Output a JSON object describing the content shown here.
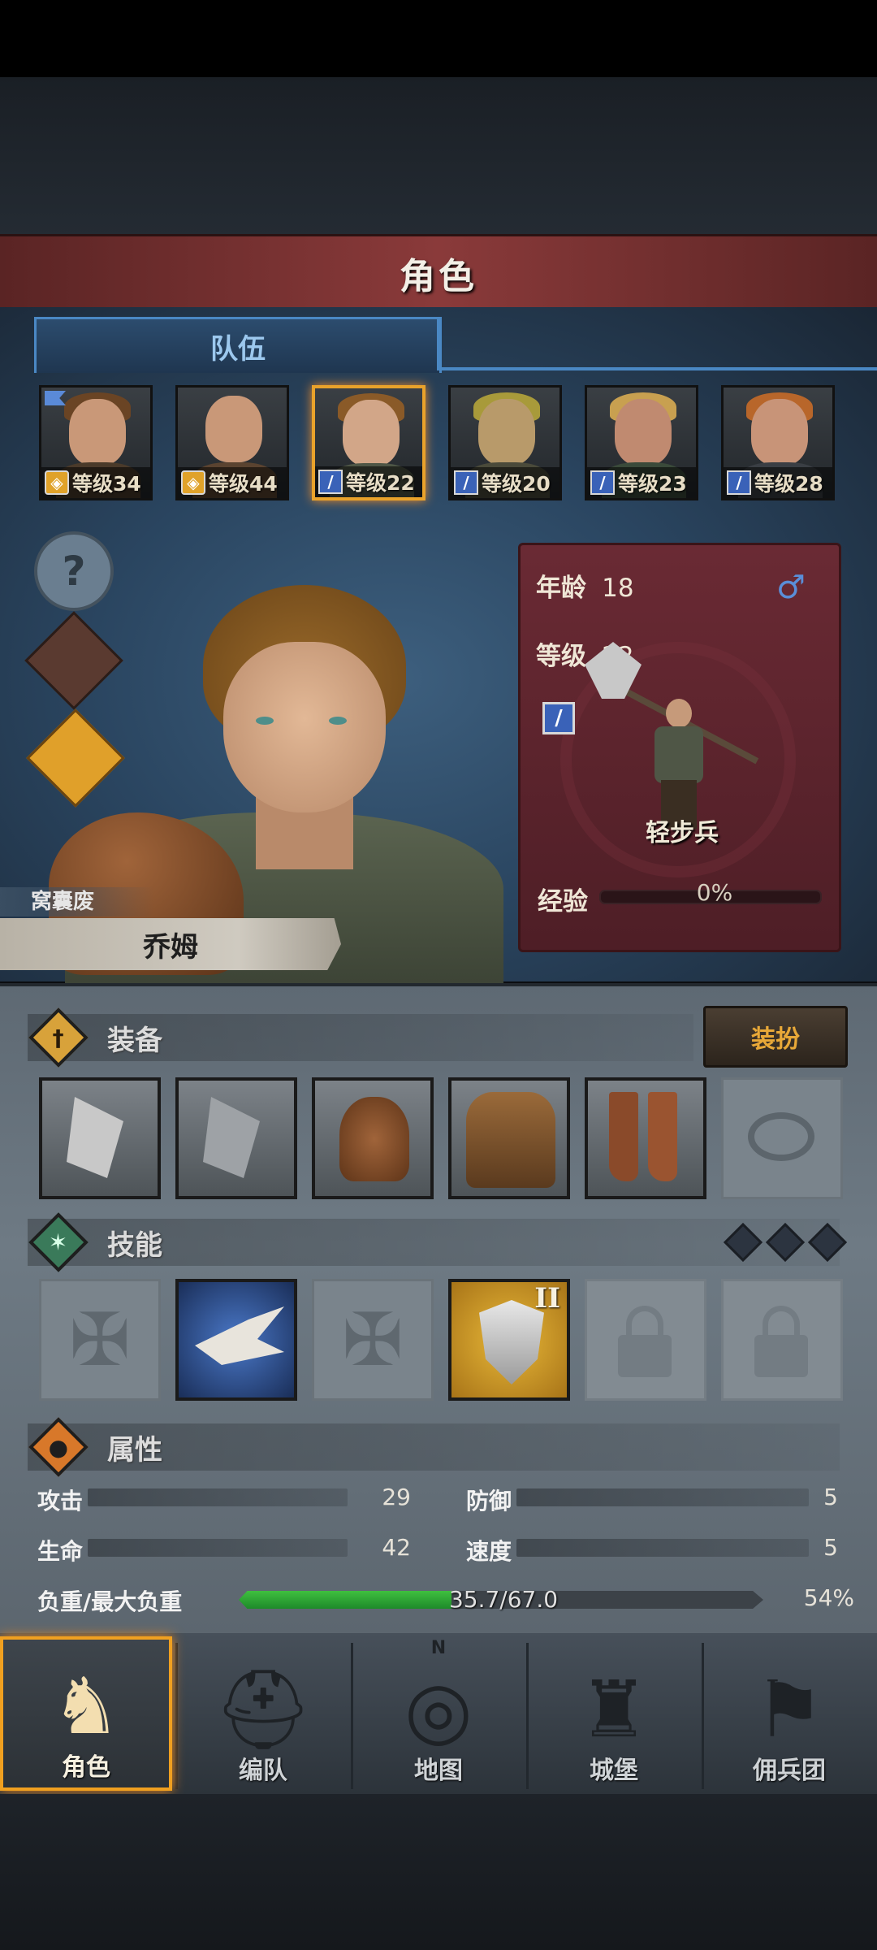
{
  "header": {
    "title": "角色"
  },
  "tabs": {
    "team": "队伍"
  },
  "roster": [
    {
      "level": "等级34",
      "class": "shield",
      "selected": false
    },
    {
      "level": "等级44",
      "class": "shield",
      "selected": false
    },
    {
      "level": "等级22",
      "class": "sword",
      "selected": true
    },
    {
      "level": "等级20",
      "class": "sword",
      "selected": false
    },
    {
      "level": "等级23",
      "class": "sword",
      "selected": false
    },
    {
      "level": "等级28",
      "class": "sword",
      "selected": false
    }
  ],
  "hero": {
    "title": "窝囊废",
    "name": "乔姆",
    "age_label": "年龄",
    "age": "18",
    "gender_symbol": "♂",
    "level_label": "等级",
    "level": "22",
    "unit": "轻步兵",
    "exp_label": "经验",
    "exp": "0%",
    "exp_fraction": 0
  },
  "equipment": {
    "title": "装备",
    "dress_button": "装扮",
    "slots": [
      "axe",
      "axe",
      "helmet",
      "armor",
      "boots",
      "ring-empty"
    ]
  },
  "skills": {
    "title": "技能",
    "slots": [
      "empty",
      "charge",
      "empty",
      "shield-II",
      "locked",
      "locked"
    ],
    "shield_rank": "II",
    "gems": 3
  },
  "attributes": {
    "title": "属性",
    "attack_label": "攻击",
    "attack": "29",
    "defense_label": "防御",
    "defense": "5",
    "hp_label": "生命",
    "hp": "42",
    "speed_label": "速度",
    "speed": "5",
    "load_label": "负重/最大负重",
    "load": "35.7/67.0",
    "load_pct": "54%",
    "load_fraction": 0.54
  },
  "nav": [
    {
      "label": "角色",
      "icon": "knight-icon",
      "active": true
    },
    {
      "label": "编队",
      "icon": "helmet-icon",
      "active": false
    },
    {
      "label": "地图",
      "icon": "compass-icon",
      "active": false,
      "compass_n": "N"
    },
    {
      "label": "城堡",
      "icon": "castle-icon",
      "active": false
    },
    {
      "label": "佣兵团",
      "icon": "banner-icon",
      "active": false
    }
  ],
  "colors": {
    "accent": "#f0a020",
    "banner": "#8a3a3a",
    "tab": "#4a88c4",
    "card": "#6a2a34",
    "load": "#3fbf3f"
  }
}
